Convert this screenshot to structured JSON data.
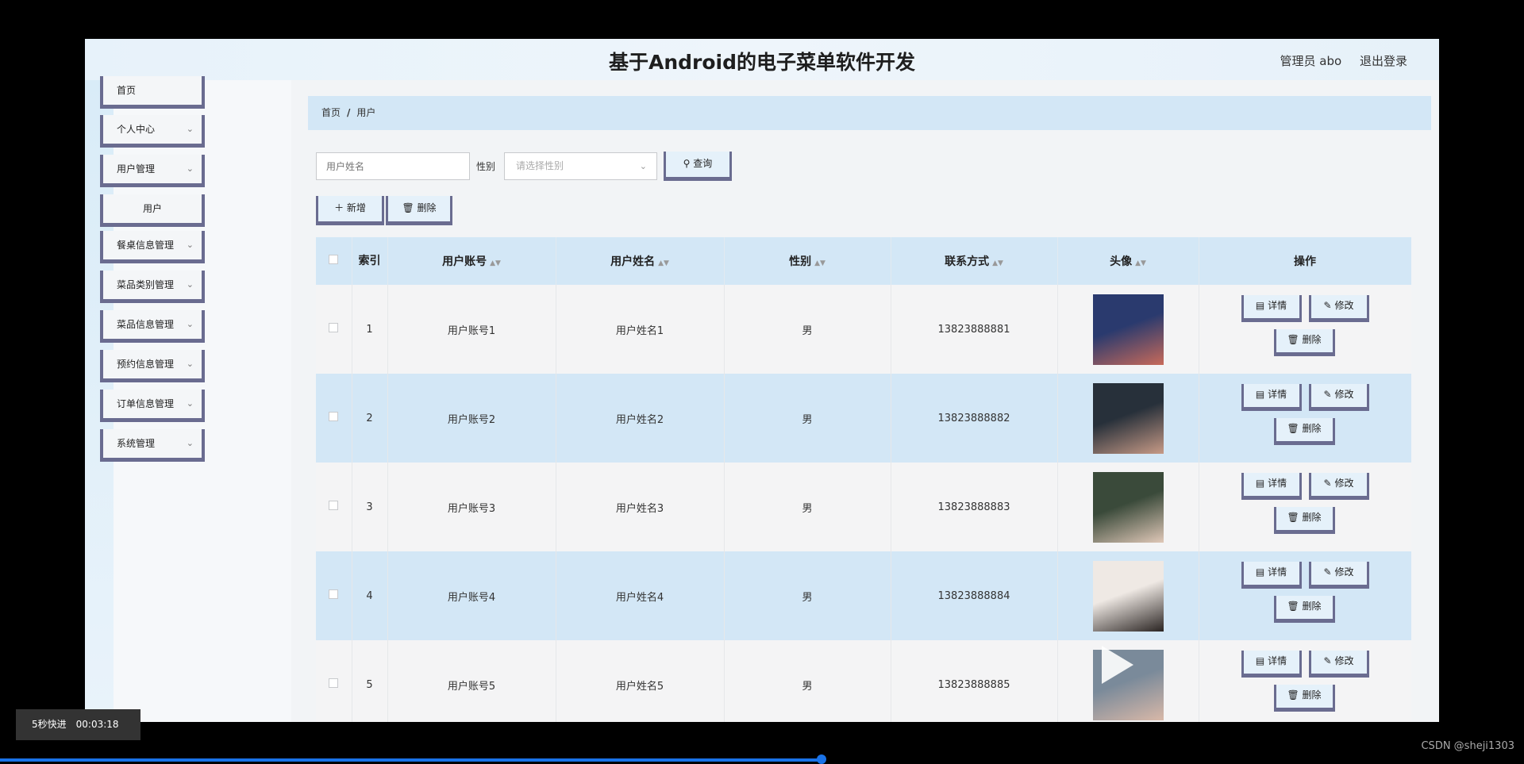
{
  "header": {
    "title": "基于Android的电子菜单软件开发",
    "user": "管理员 abo",
    "logout": "退出登录"
  },
  "sidebar": {
    "items": [
      {
        "label": "首页",
        "chevron": false
      },
      {
        "label": "个人中心",
        "chevron": true
      },
      {
        "label": "用户管理",
        "chevron": true
      },
      {
        "label": "用户",
        "chevron": false,
        "sub": true
      },
      {
        "label": "餐桌信息管理",
        "chevron": true
      },
      {
        "label": "菜品类别管理",
        "chevron": true
      },
      {
        "label": "菜品信息管理",
        "chevron": true
      },
      {
        "label": "预约信息管理",
        "chevron": true
      },
      {
        "label": "订单信息管理",
        "chevron": true
      },
      {
        "label": "系统管理",
        "chevron": true
      }
    ]
  },
  "breadcrumb": {
    "home": "首页",
    "sep": "/",
    "current": "用户"
  },
  "search": {
    "name_placeholder": "用户姓名",
    "gender_label": "性别",
    "gender_placeholder": "请选择性别",
    "query_label": "查询"
  },
  "toolbar": {
    "add_label": "新增",
    "delete_label": "删除"
  },
  "table": {
    "headers": {
      "index": "索引",
      "account": "用户账号",
      "name": "用户姓名",
      "gender": "性别",
      "phone": "联系方式",
      "avatar": "头像",
      "ops": "操作"
    },
    "op_labels": {
      "detail": "详情",
      "edit": "修改",
      "delete": "删除"
    },
    "rows": [
      {
        "index": "1",
        "account": "用户账号1",
        "name": "用户姓名1",
        "gender": "男",
        "phone": "13823888881",
        "avatar_colors": [
          "#2a3a6e",
          "#c86a5a"
        ]
      },
      {
        "index": "2",
        "account": "用户账号2",
        "name": "用户姓名2",
        "gender": "男",
        "phone": "13823888882",
        "avatar_colors": [
          "#27303a",
          "#c79a86"
        ]
      },
      {
        "index": "3",
        "account": "用户账号3",
        "name": "用户姓名3",
        "gender": "男",
        "phone": "13823888883",
        "avatar_colors": [
          "#3a4a3a",
          "#e0c8b8"
        ]
      },
      {
        "index": "4",
        "account": "用户账号4",
        "name": "用户姓名4",
        "gender": "男",
        "phone": "13823888884",
        "avatar_colors": [
          "#efe9e4",
          "#2a2422"
        ]
      },
      {
        "index": "5",
        "account": "用户账号5",
        "name": "用户姓名5",
        "gender": "男",
        "phone": "13823888885",
        "avatar_colors": [
          "#7a8a9a",
          "#d8b8a8"
        ]
      }
    ]
  },
  "video": {
    "label": "5秒快进",
    "time": "00:03:18",
    "progress": 0.539
  },
  "watermark": "CSDN @sheji1303",
  "colors": {
    "accent": "#6a6c90",
    "header_bg": "#d3e7f6",
    "progress": "#1a73e8"
  }
}
